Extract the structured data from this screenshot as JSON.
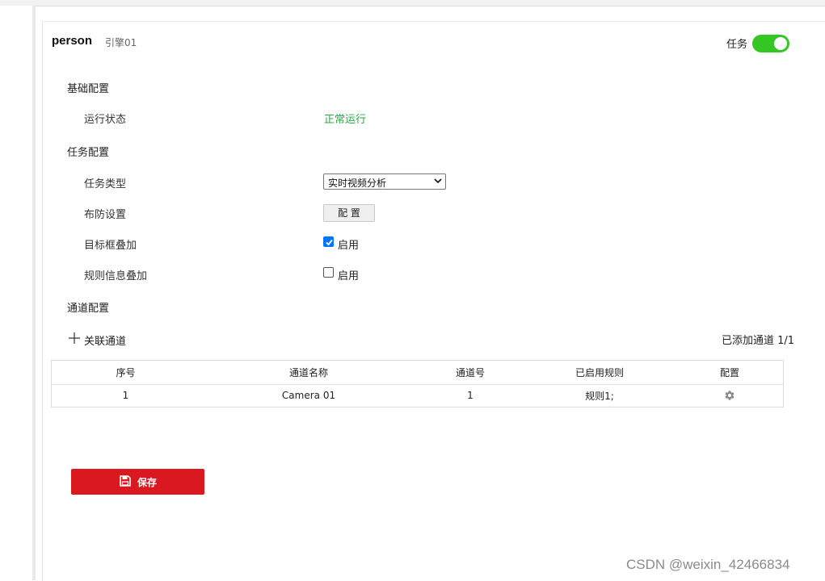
{
  "header": {
    "title": "person",
    "subtitle": "引擎01",
    "task_toggle_label": "任务",
    "task_enabled": true
  },
  "basic_config": {
    "section_title": "基础配置",
    "run_status_label": "运行状态",
    "run_status_value": "正常运行"
  },
  "task_config": {
    "section_title": "任务配置",
    "task_type_label": "任务类型",
    "task_type_value": "实时视频分析",
    "arming_label": "布防设置",
    "arming_button": "配 置",
    "target_overlay_label": "目标框叠加",
    "target_overlay_check_label": "启用",
    "target_overlay_checked": true,
    "rule_overlay_label": "规则信息叠加",
    "rule_overlay_check_label": "启用",
    "rule_overlay_checked": false
  },
  "channel_config": {
    "section_title": "通道配置",
    "add_channel_label": "关联通道",
    "added_count": "已添加通道 1/1",
    "table": {
      "headers": [
        "序号",
        "通道名称",
        "通道号",
        "已启用规则",
        "配置"
      ],
      "rows": [
        [
          "1",
          "Camera 01",
          "1",
          "规则1;"
        ]
      ]
    }
  },
  "save_button": "保存",
  "watermark": "CSDN @weixin_42466834",
  "colors": {
    "toggle_on": "#34c724",
    "status_ok": "#28a745",
    "save_bg": "#d9181f",
    "checkbox_checked": "#0075ff"
  },
  "icons": {
    "add": "plus-icon",
    "config": "gear-icon",
    "save": "save-icon",
    "select": "chevron-down-icon"
  }
}
